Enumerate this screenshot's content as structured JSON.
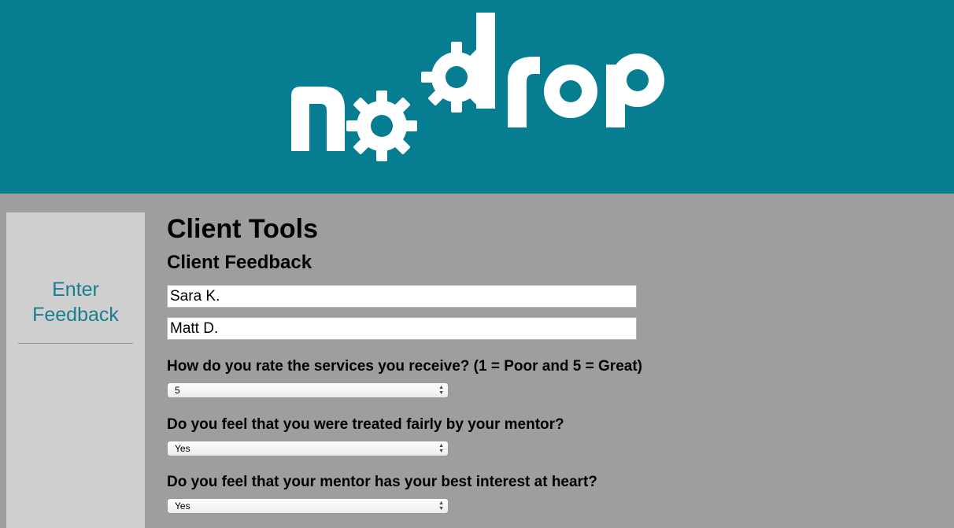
{
  "header": {
    "logo_text": "nodrop",
    "brand_color": "#077d91"
  },
  "sidebar": {
    "items": [
      {
        "label": "Enter Feedback"
      }
    ]
  },
  "main": {
    "title": "Client Tools",
    "subtitle": "Client Feedback",
    "fields": [
      {
        "value": "Sara K."
      },
      {
        "value": "Matt D."
      }
    ],
    "questions": [
      {
        "label": "How do you rate the services you receive? (1 = Poor and 5 = Great)",
        "selected": "5"
      },
      {
        "label": "Do you feel that you were treated fairly by your mentor?",
        "selected": "Yes"
      },
      {
        "label": "Do you feel that your mentor has your best interest at heart?",
        "selected": "Yes"
      }
    ]
  }
}
